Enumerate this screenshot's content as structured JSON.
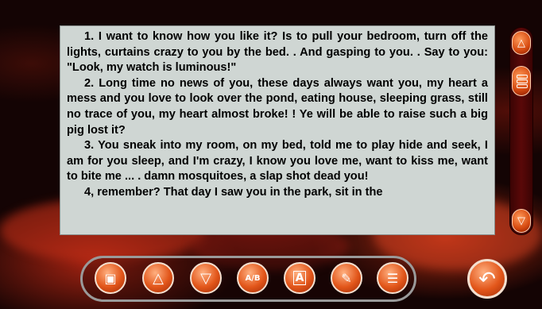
{
  "reader": {
    "paragraphs": [
      "1. I want to know how you like it? Is to pull your bedroom, turn off the lights, curtains crazy to you by the bed. . And gasping to you. . Say to you: \"Look, my watch is luminous!\"",
      "2. Long time no news of you, these days always want you, my heart a mess and you love to look over the pond, eating house, sleeping grass, still no trace of you, my heart almost broke! ! Ye will be able to raise such a big pig lost it?",
      "3. You sneak into my room, on my bed, told me to play hide and seek, I am for you sleep, and I'm crazy, I know you love me, want to kiss me, want to bite me ... . damn mosquitoes, a slap shot dead you!",
      "4, remember? That day I saw you in the park, sit in the"
    ]
  },
  "scrollbar": {
    "up_icon": "triangle-up-icon",
    "down_icon": "triangle-down-icon",
    "thumb_icon": "grip-icon"
  },
  "toolbar": {
    "buttons": [
      {
        "name": "bookmark-icon",
        "glyph": "▣"
      },
      {
        "name": "page-up-icon",
        "glyph": "△"
      },
      {
        "name": "page-down-icon",
        "glyph": "▽"
      },
      {
        "name": "ab-compare-icon",
        "glyph": "A/B"
      },
      {
        "name": "font-size-icon",
        "glyph": "A"
      },
      {
        "name": "edit-icon",
        "glyph": "✎"
      },
      {
        "name": "list-icon",
        "glyph": "☰"
      }
    ]
  },
  "back_button": {
    "icon": "return-arrow-icon",
    "glyph": "↶"
  },
  "colors": {
    "accent": "#e2561a",
    "text_panel": "#cfd6d3",
    "background": "#140404"
  }
}
